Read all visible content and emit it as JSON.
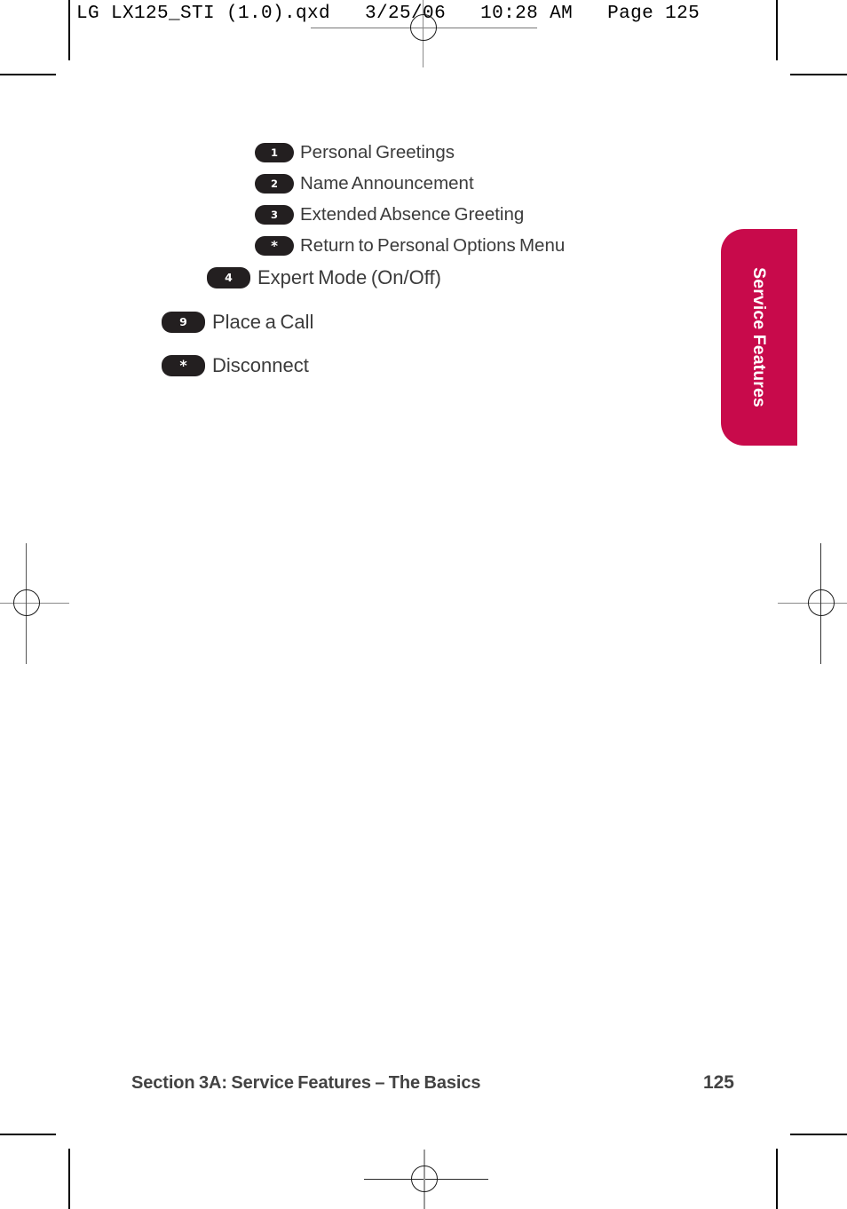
{
  "preflight": {
    "header_text": "LG LX125_STI (1.0).qxd   3/25/06   10:28 AM   Page 125"
  },
  "side_tab": {
    "label": "Service Features",
    "color": "#c80a4b",
    "text_color": "#ffffff"
  },
  "menu": {
    "badge_color": "#231f20",
    "text_color": "#3b3b3b",
    "items": [
      {
        "key": "1",
        "label": "Personal Greetings",
        "indent": 287,
        "size": "sm"
      },
      {
        "key": "2",
        "label": "Name Announcement",
        "indent": 287,
        "size": "sm"
      },
      {
        "key": "3",
        "label": "Extended Absence Greeting",
        "indent": 287,
        "size": "sm"
      },
      {
        "key": "*",
        "label": "Return to Personal Options Menu",
        "indent": 287,
        "size": "sm"
      },
      {
        "key": "4",
        "label": "Expert Mode (On/Off)",
        "indent": 233,
        "size": "md"
      },
      {
        "key": "9",
        "label": "Place a Call",
        "indent": 182,
        "size": "md"
      },
      {
        "key": "*",
        "label": "Disconnect",
        "indent": 182,
        "size": "md"
      }
    ]
  },
  "footer": {
    "section": "Section 3A: Service Features – The Basics",
    "page_number": "125"
  }
}
